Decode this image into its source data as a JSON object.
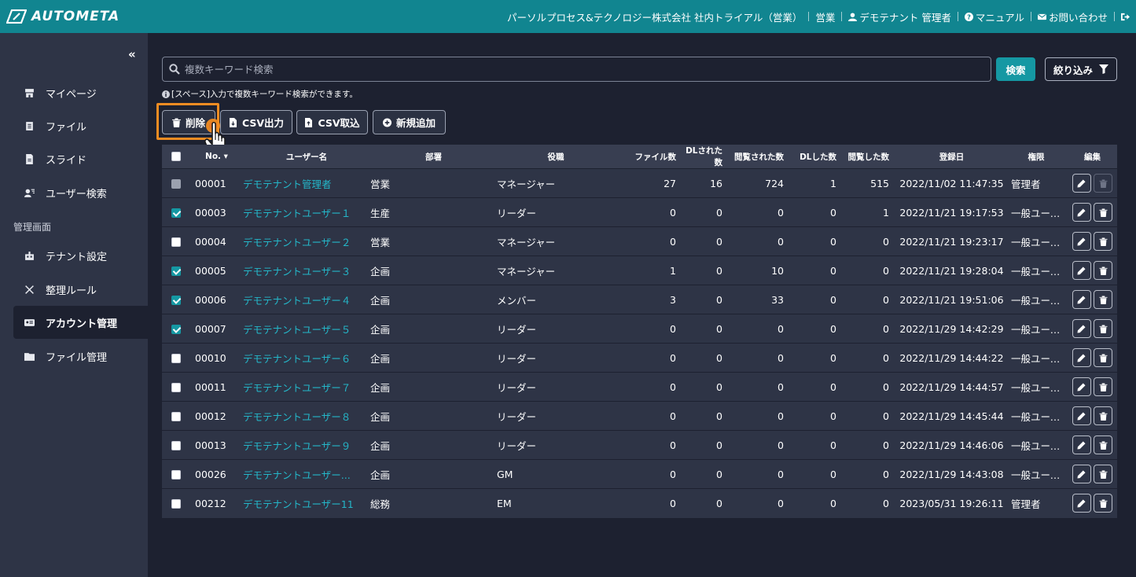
{
  "header": {
    "logo_text": "AUTOMETA",
    "company": "パーソルプロセス&テクノロジー株式会社 社内トライアル（営業）",
    "department": "営業",
    "user": "デモテナント 管理者",
    "manual": "マニュアル",
    "contact": "お問い合わせ"
  },
  "sidebar": {
    "collapse": "«",
    "items": [
      {
        "label": "マイページ",
        "icon": "home-icon"
      },
      {
        "label": "ファイル",
        "icon": "file-icon"
      },
      {
        "label": "スライド",
        "icon": "slide-icon"
      },
      {
        "label": "ユーザー検索",
        "icon": "user-search-icon"
      }
    ],
    "section": "管理画面",
    "admin_items": [
      {
        "label": "テナント設定",
        "icon": "building-icon"
      },
      {
        "label": "整理ルール",
        "icon": "tools-icon"
      },
      {
        "label": "アカウント管理",
        "icon": "id-card-icon",
        "active": true
      },
      {
        "label": "ファイル管理",
        "icon": "folder-icon"
      }
    ]
  },
  "search": {
    "placeholder": "複数キーワード検索",
    "button": "検索",
    "filter": "絞り込み",
    "hint": "[スペース]入力で複数キーワード検索ができます。"
  },
  "actions": {
    "delete": "削除",
    "csv_export": "CSV出力",
    "csv_import": "CSV取込",
    "add_new": "新規追加"
  },
  "table": {
    "headers": [
      "No. ▾",
      "ユーザー名",
      "部署",
      "役職",
      "ファイル数",
      "DLされた数",
      "閲覧された数",
      "DLした数",
      "閲覧した数",
      "登録日",
      "権限",
      "編集"
    ],
    "rows": [
      {
        "no": "00001",
        "name": "デモテナント管理者",
        "dept": "営業",
        "title": "マネージャー",
        "files": "27",
        "dled": "16",
        "viewed": "724",
        "dl": "1",
        "view": "515",
        "date": "2022/11/02 11:47:35",
        "role": "管理者",
        "checked": "disabled"
      },
      {
        "no": "00003",
        "name": "デモテナントユーザー１",
        "dept": "生産",
        "title": "リーダー",
        "files": "0",
        "dled": "0",
        "viewed": "0",
        "dl": "0",
        "view": "1",
        "date": "2022/11/21 19:17:53",
        "role": "一般ユーザー",
        "checked": "on"
      },
      {
        "no": "00004",
        "name": "デモテナントユーザー２",
        "dept": "営業",
        "title": "マネージャー",
        "files": "0",
        "dled": "0",
        "viewed": "0",
        "dl": "0",
        "view": "0",
        "date": "2022/11/21 19:23:17",
        "role": "一般ユーザー",
        "checked": "off"
      },
      {
        "no": "00005",
        "name": "デモテナントユーザー３",
        "dept": "企画",
        "title": "マネージャー",
        "files": "1",
        "dled": "0",
        "viewed": "10",
        "dl": "0",
        "view": "0",
        "date": "2022/11/21 19:28:04",
        "role": "一般ユーザー",
        "checked": "on"
      },
      {
        "no": "00006",
        "name": "デモテナントユーザー４",
        "dept": "企画",
        "title": "メンバー",
        "files": "3",
        "dled": "0",
        "viewed": "33",
        "dl": "0",
        "view": "0",
        "date": "2022/11/21 19:51:06",
        "role": "一般ユーザー",
        "checked": "on"
      },
      {
        "no": "00007",
        "name": "デモテナントユーザー５",
        "dept": "企画",
        "title": "リーダー",
        "files": "0",
        "dled": "0",
        "viewed": "0",
        "dl": "0",
        "view": "0",
        "date": "2022/11/29 14:42:29",
        "role": "一般ユーザー",
        "checked": "on"
      },
      {
        "no": "00010",
        "name": "デモテナントユーザー６",
        "dept": "企画",
        "title": "リーダー",
        "files": "0",
        "dled": "0",
        "viewed": "0",
        "dl": "0",
        "view": "0",
        "date": "2022/11/29 14:44:22",
        "role": "一般ユーザー",
        "checked": "off"
      },
      {
        "no": "00011",
        "name": "デモテナントユーザー７",
        "dept": "企画",
        "title": "リーダー",
        "files": "0",
        "dled": "0",
        "viewed": "0",
        "dl": "0",
        "view": "0",
        "date": "2022/11/29 14:44:57",
        "role": "一般ユーザー",
        "checked": "off"
      },
      {
        "no": "00012",
        "name": "デモテナントユーザー８",
        "dept": "企画",
        "title": "リーダー",
        "files": "0",
        "dled": "0",
        "viewed": "0",
        "dl": "0",
        "view": "0",
        "date": "2022/11/29 14:45:44",
        "role": "一般ユーザー",
        "checked": "off"
      },
      {
        "no": "00013",
        "name": "デモテナントユーザー９",
        "dept": "企画",
        "title": "リーダー",
        "files": "0",
        "dled": "0",
        "viewed": "0",
        "dl": "0",
        "view": "0",
        "date": "2022/11/29 14:46:06",
        "role": "一般ユーザー",
        "checked": "off"
      },
      {
        "no": "00026",
        "name": "デモテナントユーザー...",
        "dept": "企画",
        "title": "GM",
        "files": "0",
        "dled": "0",
        "viewed": "0",
        "dl": "0",
        "view": "0",
        "date": "2022/11/29 14:43:08",
        "role": "一般ユーザー",
        "checked": "off"
      },
      {
        "no": "00212",
        "name": "デモテナントユーザー11",
        "dept": "総務",
        "title": "EM",
        "files": "0",
        "dled": "0",
        "viewed": "0",
        "dl": "0",
        "view": "0",
        "date": "2023/05/31 19:26:11",
        "role": "管理者",
        "checked": "off"
      }
    ]
  },
  "colors": {
    "header": "#118590",
    "accent": "#1598a3",
    "link": "#24b6c8",
    "highlight": "#f08c22"
  }
}
